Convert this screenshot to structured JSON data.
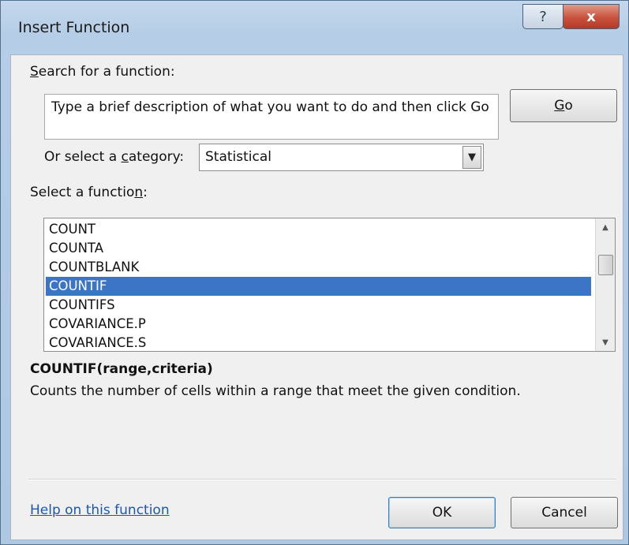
{
  "window": {
    "title": "Insert Function"
  },
  "titlebar_buttons": {
    "help": "?",
    "close": "x"
  },
  "search": {
    "label_prefix": "",
    "label_accel": "S",
    "label_rest": "earch for a function:",
    "text": "Type a brief description of what you want to do and then click Go",
    "go_prefix": "",
    "go_accel": "G",
    "go_rest": "o"
  },
  "category": {
    "label_prefix": "Or select a ",
    "label_accel": "c",
    "label_rest": "ategory:",
    "selected": "Statistical",
    "arrow_icon": "chevron-down-icon"
  },
  "functions": {
    "label_prefix": "Select a functio",
    "label_accel": "n",
    "label_rest": ":",
    "items": [
      "COUNT",
      "COUNTA",
      "COUNTBLANK",
      "COUNTIF",
      "COUNTIFS",
      "COVARIANCE.P",
      "COVARIANCE.S"
    ],
    "selected_item": "COUNTIF"
  },
  "details": {
    "signature": "COUNTIF(range,criteria)",
    "description": "Counts the number of cells within a range that meet the given condition."
  },
  "footer": {
    "help_link": "Help on this function",
    "ok_label": "OK",
    "cancel_label": "Cancel"
  },
  "colors": {
    "selection": "#3c75c6",
    "link": "#1b57b1",
    "close_button": "#c8523e"
  }
}
